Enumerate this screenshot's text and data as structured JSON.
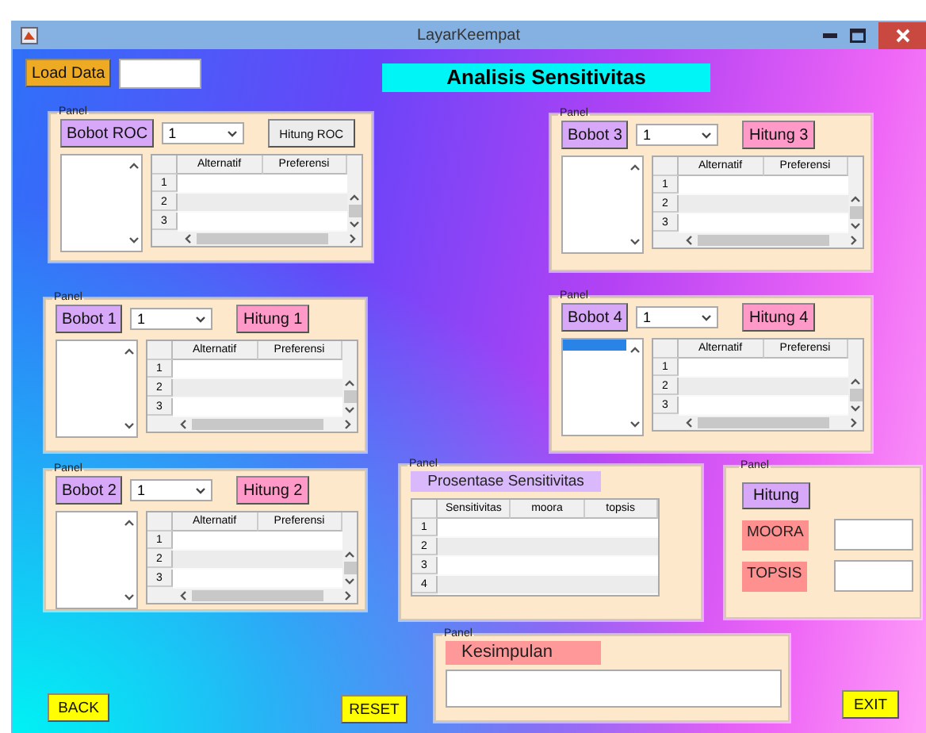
{
  "window": {
    "title": "LayarKeempat"
  },
  "load_button": "Load Data",
  "heading": "Analisis Sensitivitas",
  "weight_panels": [
    {
      "legend": "Panel",
      "weight_button": "Bobot ROC",
      "dropdown": "1",
      "compute_button": {
        "label": "Hitung ROC",
        "color": "#ececec"
      },
      "listbox_selected": false,
      "columns": [
        "Alternatif",
        "Preferensi"
      ],
      "rows": [
        "1",
        "2",
        "3"
      ]
    },
    {
      "legend": "Panel",
      "weight_button": "Bobot 3",
      "dropdown": "1",
      "compute_button": {
        "label": "Hitung 3",
        "color": "#ff99c8"
      },
      "listbox_selected": false,
      "columns": [
        "Alternatif",
        "Preferensi"
      ],
      "rows": [
        "1",
        "2",
        "3"
      ]
    },
    {
      "legend": "Panel",
      "weight_button": "Bobot 1",
      "dropdown": "1",
      "compute_button": {
        "label": "Hitung 1",
        "color": "#ff99c8"
      },
      "listbox_selected": false,
      "columns": [
        "Alternatif",
        "Preferensi"
      ],
      "rows": [
        "1",
        "2",
        "3"
      ]
    },
    {
      "legend": "Panel",
      "weight_button": "Bobot 4",
      "dropdown": "1",
      "compute_button": {
        "label": "Hitung 4",
        "color": "#ff99c8"
      },
      "listbox_selected": true,
      "columns": [
        "Alternatif",
        "Preferensi"
      ],
      "rows": [
        "1",
        "2",
        "3"
      ]
    },
    {
      "legend": "Panel",
      "weight_button": "Bobot 2",
      "dropdown": "1",
      "compute_button": {
        "label": "Hitung 2",
        "color": "#ff99c8"
      },
      "listbox_selected": false,
      "columns": [
        "Alternatif",
        "Preferensi"
      ],
      "rows": [
        "1",
        "2",
        "3"
      ]
    }
  ],
  "sensitivity_panel": {
    "legend": "Panel",
    "title": "Prosentase Sensitivitas",
    "columns": [
      "Sensitivitas",
      "moora",
      "topsis"
    ],
    "rows": [
      "1",
      "2",
      "3",
      "4"
    ]
  },
  "result_panel": {
    "legend": "Panel",
    "button": "Hitung",
    "labels": [
      "MOORA",
      "TOPSIS"
    ]
  },
  "conclusion_panel": {
    "legend": "Panel",
    "title": "Kesimpulan"
  },
  "buttons": [
    "BACK",
    "RESET",
    "EXIT"
  ]
}
